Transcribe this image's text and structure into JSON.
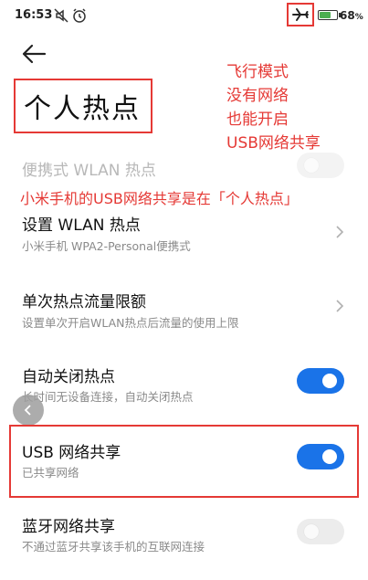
{
  "status_bar": {
    "time": "16:53",
    "icons": [
      "mute-icon",
      "alarm-icon",
      "airplane-icon",
      "battery-icon"
    ],
    "battery_percent": "68",
    "battery_unit": "%",
    "battery_level": 0.68,
    "accent_battery": "#4caf50"
  },
  "header": {
    "title": "个人热点"
  },
  "annotation": {
    "lines": [
      "飞行模式",
      "没有网络",
      "也能开启",
      "USB网络共享"
    ],
    "caption": "小米手机的USB网络共享是在「个人热点」",
    "color": "#e53935"
  },
  "settings": {
    "portable_hotspot": {
      "title": "便携式 WLAN 热点",
      "enabled": false,
      "disabled": true
    },
    "setup_hotspot": {
      "title": "设置 WLAN 热点",
      "subtitle": "小米手机 WPA2-Personal便携式"
    },
    "data_limit": {
      "title": "单次热点流量限额",
      "subtitle": "设置单次开启WLAN热点后流量的使用上限"
    },
    "auto_off": {
      "title": "自动关闭热点",
      "subtitle": "长时间无设备连接，自动关闭热点",
      "enabled": true
    },
    "usb_tethering": {
      "title": "USB 网络共享",
      "subtitle": "已共享网络",
      "enabled": true
    },
    "bt_tethering": {
      "title": "蓝牙网络共享",
      "subtitle": "不通过蓝牙共享该手机的互联网连接",
      "enabled": false
    }
  },
  "colors": {
    "toggle_on": "#1a73e8",
    "toggle_off": "#ececec",
    "highlight": "#e53935"
  }
}
